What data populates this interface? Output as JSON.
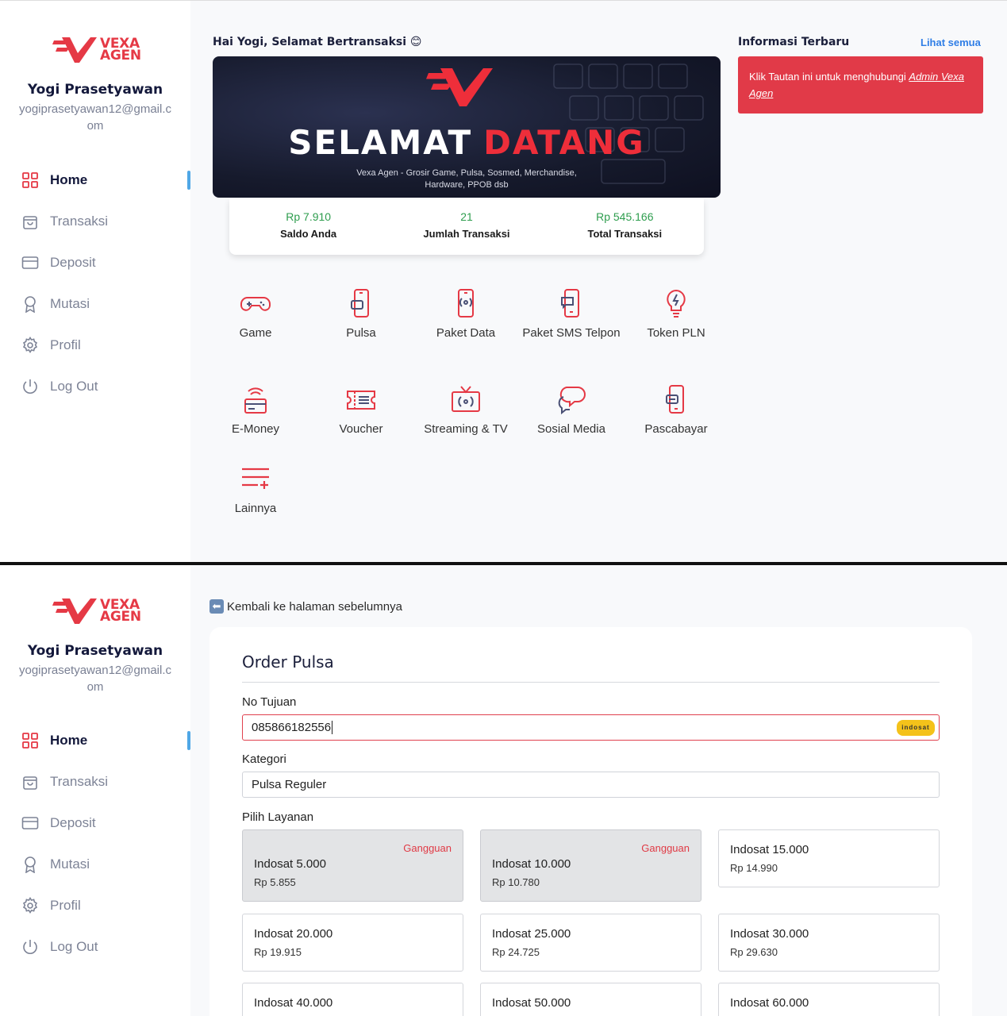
{
  "brand": {
    "line1": "VEXA",
    "line2": "AGEN"
  },
  "user": {
    "name": "Yogi Prasetyawan",
    "email": "yogiprasetyawan12@gmail.com"
  },
  "nav": [
    {
      "label": "Home",
      "icon": "grid-icon",
      "active": true
    },
    {
      "label": "Transaksi",
      "icon": "shopping-bag-icon"
    },
    {
      "label": "Deposit",
      "icon": "credit-card-icon"
    },
    {
      "label": "Mutasi",
      "icon": "award-icon"
    },
    {
      "label": "Profil",
      "icon": "gear-icon"
    },
    {
      "label": "Log Out",
      "icon": "power-icon"
    }
  ],
  "home": {
    "greeting": "Hai Yogi, Selamat Bertransaksi 😊",
    "banner": {
      "title_white": "SELAMAT",
      "title_red": "DATANG",
      "subtitle": "Vexa Agen - Grosir Game, Pulsa, Sosmed, Merchandise, Hardware, PPOB dsb"
    },
    "stats": [
      {
        "value": "Rp 7.910",
        "label": "Saldo Anda"
      },
      {
        "value": "21",
        "label": "Jumlah Transaksi"
      },
      {
        "value": "Rp 545.166",
        "label": "Total Transaksi"
      }
    ],
    "menu": [
      {
        "label": "Game",
        "icon": "gamepad-icon"
      },
      {
        "label": "Pulsa",
        "icon": "phone-credit-icon"
      },
      {
        "label": "Paket Data",
        "icon": "phone-signal-icon"
      },
      {
        "label": "Paket SMS Telpon",
        "icon": "phone-message-icon"
      },
      {
        "label": "Token PLN",
        "icon": "lightbulb-icon"
      },
      {
        "label": "E-Money",
        "icon": "wallet-wifi-icon"
      },
      {
        "label": "Voucher",
        "icon": "ticket-icon"
      },
      {
        "label": "Streaming & TV",
        "icon": "tv-icon"
      },
      {
        "label": "Sosial Media",
        "icon": "chat-bubbles-icon"
      },
      {
        "label": "Pascabayar",
        "icon": "phone-bill-icon"
      },
      {
        "label": "Lainnya",
        "icon": "list-plus-icon"
      }
    ],
    "info": {
      "title": "Informasi Terbaru",
      "see_all": "Lihat semua",
      "alert_text": "Klik Tautan ini untuk menghubungi ",
      "alert_link": "Admin Vexa Agen"
    }
  },
  "order": {
    "back_label": "Kembali ke halaman sebelumnya",
    "back_icon": "arrow-left-icon",
    "title": "Order Pulsa",
    "no_tujuan_label": "No Tujuan",
    "no_tujuan_value": "085866182556",
    "operator_logo": "indosat",
    "kategori_label": "Kategori",
    "kategori_value": "Pulsa Reguler",
    "layanan_label": "Pilih Layanan",
    "services": [
      {
        "name": "Indosat 5.000",
        "price": "Rp 5.855",
        "status": "Gangguan"
      },
      {
        "name": "Indosat 10.000",
        "price": "Rp 10.780",
        "status": "Gangguan"
      },
      {
        "name": "Indosat 15.000",
        "price": "Rp 14.990",
        "status": ""
      },
      {
        "name": "Indosat 20.000",
        "price": "Rp 19.915",
        "status": ""
      },
      {
        "name": "Indosat 25.000",
        "price": "Rp 24.725",
        "status": ""
      },
      {
        "name": "Indosat 30.000",
        "price": "Rp 29.630",
        "status": ""
      },
      {
        "name": "Indosat 40.000",
        "price": "",
        "status": ""
      },
      {
        "name": "Indosat 50.000",
        "price": "",
        "status": ""
      },
      {
        "name": "Indosat 60.000",
        "price": "",
        "status": ""
      }
    ]
  },
  "colors": {
    "accent": "#e53945",
    "navy": "#13183b",
    "success": "#2e9d4e",
    "link": "#2f7ee6",
    "active_bar": "#4fa7e6"
  }
}
